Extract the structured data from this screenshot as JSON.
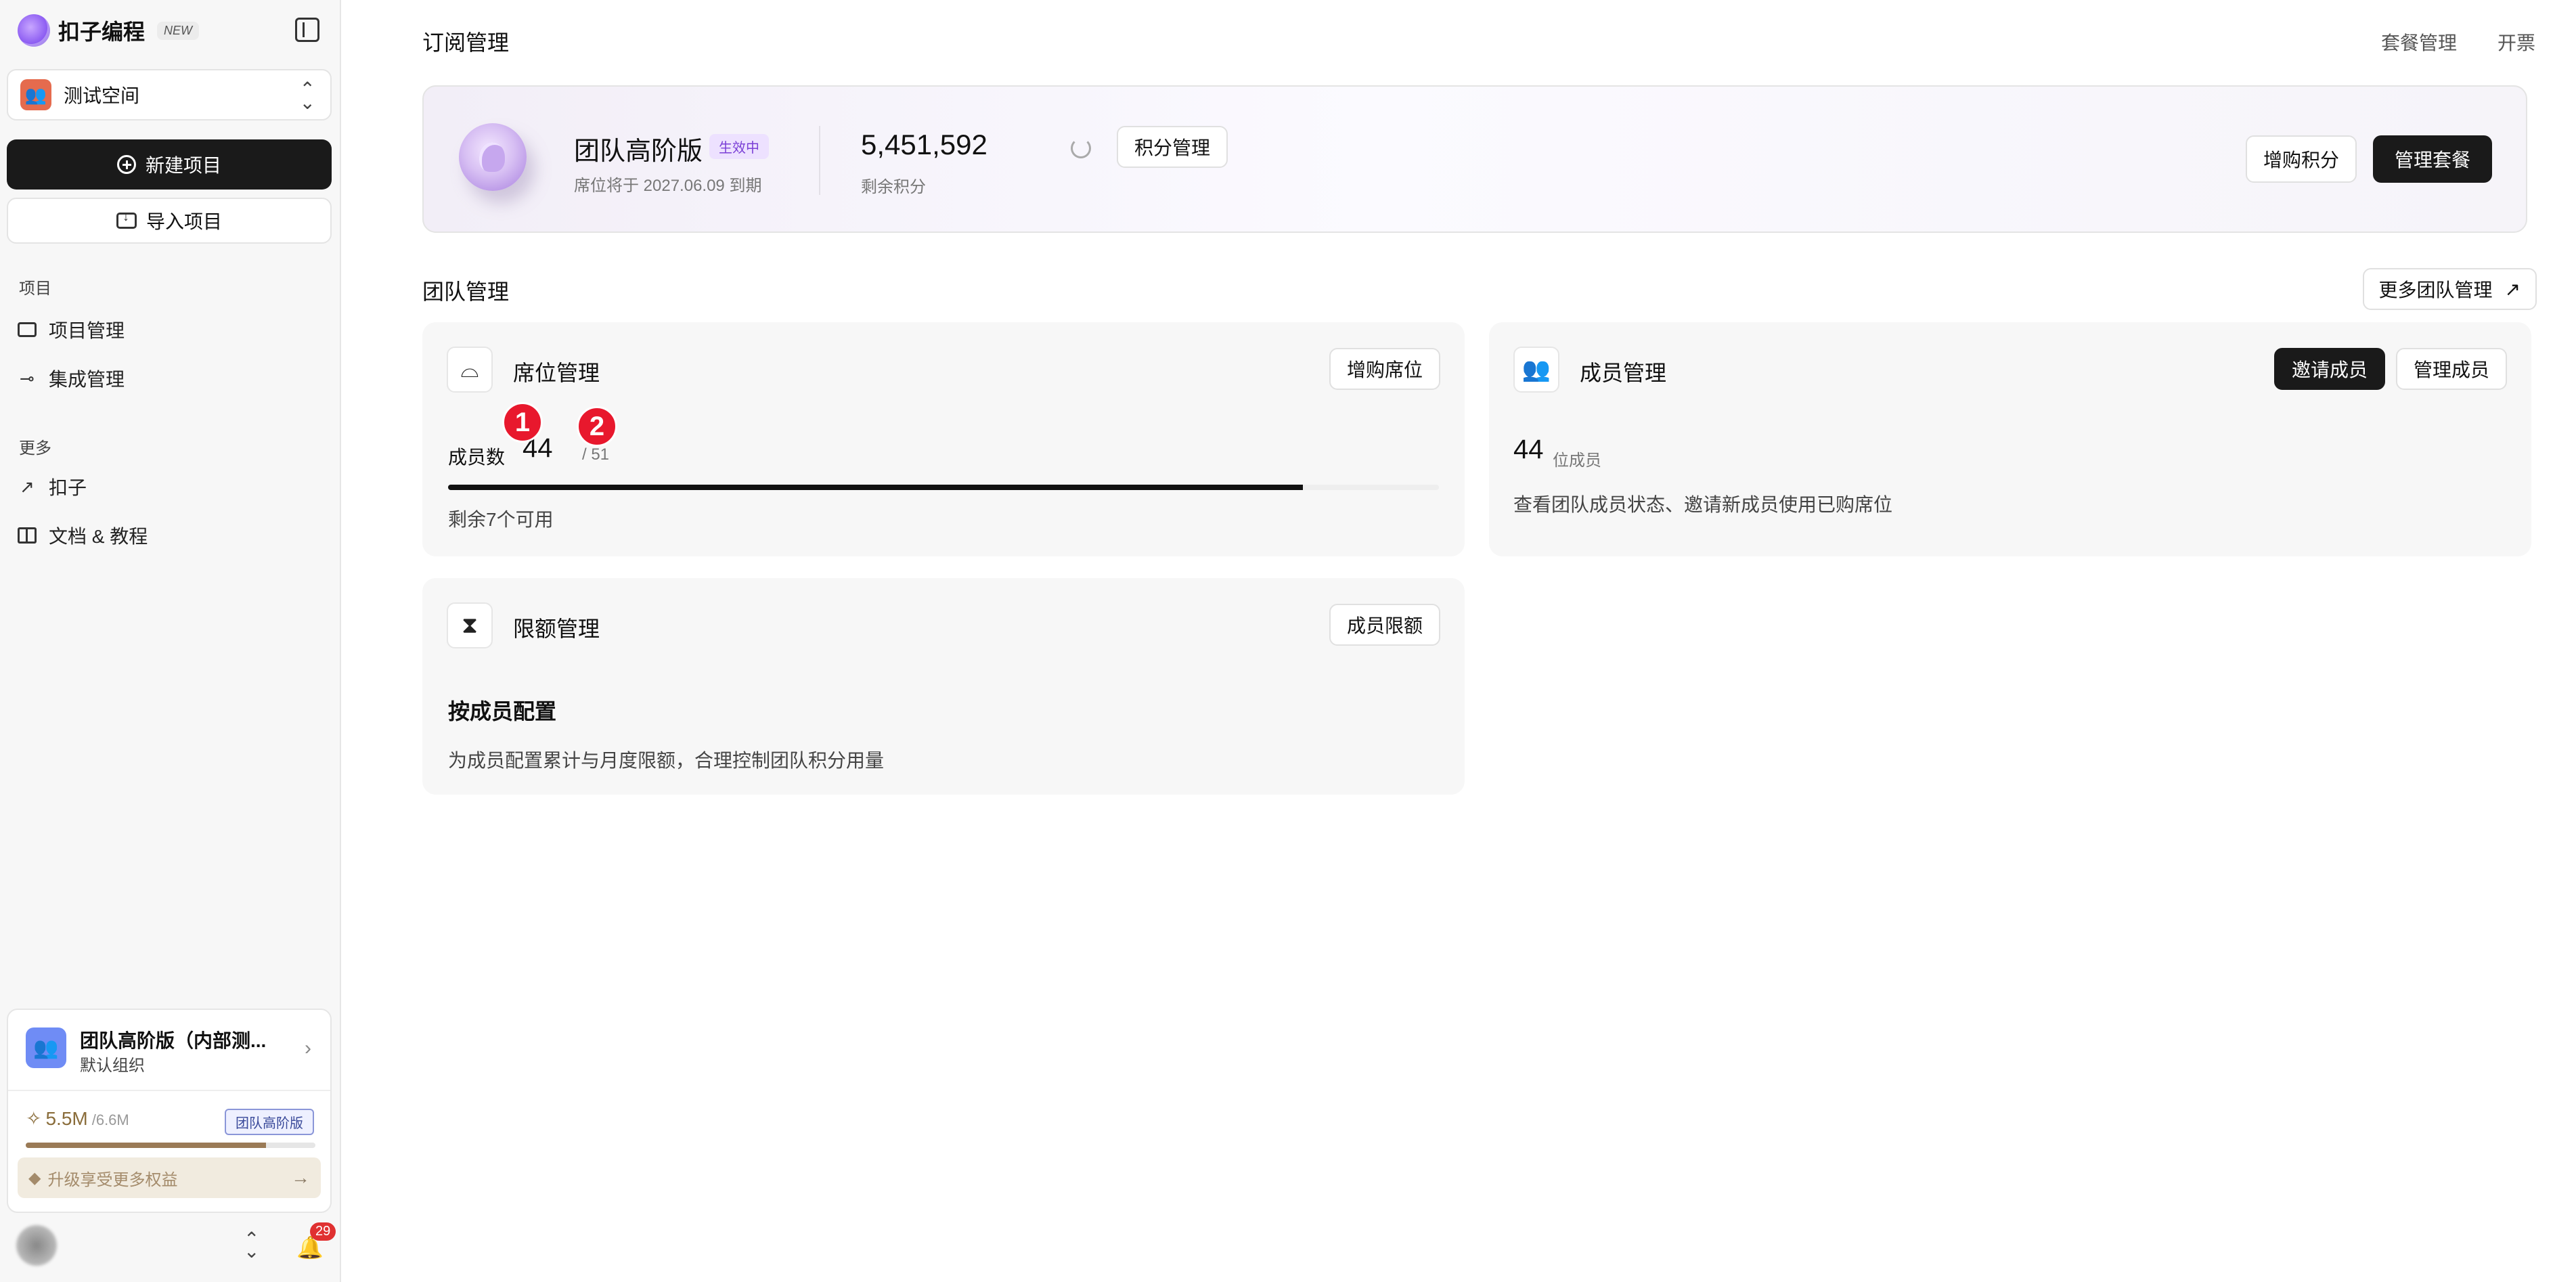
{
  "sidebar": {
    "brand_name": "扣子编程",
    "brand_badge": "NEW",
    "workspace_name": "测试空间",
    "new_project": "新建项目",
    "import_project": "导入项目",
    "section_projects": "项目",
    "nav_projects": "项目管理",
    "nav_integrations": "集成管理",
    "section_more": "更多",
    "nav_kouzi": "扣子",
    "nav_docs": "文档 & 教程",
    "org": {
      "name": "团队高阶版（内部测...",
      "sub": "默认组织",
      "credits_used": "5.5M",
      "credits_total": "/6.6M",
      "credits_fraction": 0.83,
      "badge": "团队高阶版",
      "upgrade": "升级享受更多权益"
    },
    "notifications": "29"
  },
  "header": {
    "title": "订阅管理",
    "link_plans": "套餐管理",
    "link_invoice": "开票"
  },
  "subscription": {
    "plan_name": "团队高阶版",
    "status": "生效中",
    "expiry": "席位将于 2027.06.09 到期",
    "credits": "5,451,592",
    "credits_label": "剩余积分",
    "manage_credits": "积分管理",
    "buy_credits": "增购积分",
    "manage_plan": "管理套餐"
  },
  "team": {
    "title": "团队管理",
    "more": "更多团队管理",
    "seats": {
      "title": "席位管理",
      "button": "增购席位",
      "label": "成员数",
      "used": "44",
      "total": "/ 51",
      "used_fraction": 0.863,
      "remaining": "剩余7个可用"
    },
    "members": {
      "title": "成员管理",
      "invite": "邀请成员",
      "manage": "管理成员",
      "count": "44",
      "unit": "位成员",
      "desc": "查看团队成员状态、邀请新成员使用已购席位"
    },
    "quota": {
      "title": "限额管理",
      "button": "成员限额",
      "heading": "按成员配置",
      "desc": "为成员配置累计与月度限额，合理控制团队积分用量"
    }
  },
  "markers": [
    "1",
    "2"
  ],
  "colors": {
    "accent_dark": "#1a1a1a",
    "status_purple": "#7a3fd6",
    "marker_red": "#e8182d",
    "badge_red": "#e03131"
  }
}
